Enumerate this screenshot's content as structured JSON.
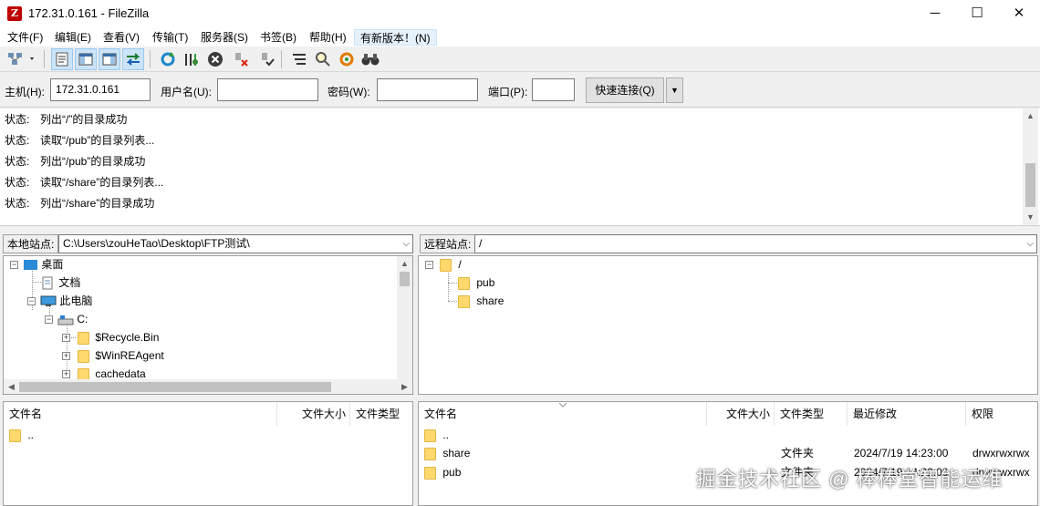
{
  "window": {
    "title": "172.31.0.161 - FileZilla",
    "app_icon_glyph": "Z",
    "controls": {
      "minimize": "─",
      "maximize": "☐",
      "close": "✕"
    }
  },
  "menu": {
    "file": "文件(F)",
    "edit": "编辑(E)",
    "view": "查看(V)",
    "transfer": "传输(T)",
    "server": "服务器(S)",
    "bookmarks": "书签(B)",
    "help": "帮助(H)",
    "update": "有新版本！(N)"
  },
  "toolbar_icons": [
    "site-manager",
    "message-log",
    "local-tree",
    "remote-tree",
    "transfer-queue",
    "refresh",
    "process-queue",
    "cancel",
    "disconnect",
    "reconnect",
    "directory-filters",
    "compare",
    "sync-browse",
    "search"
  ],
  "quickconnect": {
    "host_label": "主机(H):",
    "host_value": "172.31.0.161",
    "user_label": "用户名(U):",
    "user_value": "",
    "pass_label": "密码(W):",
    "pass_value": "",
    "port_label": "端口(P):",
    "port_value": "",
    "button": "快速连接(Q)"
  },
  "log": [
    {
      "type": "状态:",
      "text": "列出“/”的目录成功"
    },
    {
      "type": "状态:",
      "text": "读取“/pub”的目录列表..."
    },
    {
      "type": "状态:",
      "text": "列出“/pub”的目录成功"
    },
    {
      "type": "状态:",
      "text": "读取“/share”的目录列表..."
    },
    {
      "type": "状态:",
      "text": "列出“/share”的目录成功"
    }
  ],
  "local": {
    "label": "本地站点:",
    "path": "C:\\Users\\zouHeTao\\Desktop\\FTP测试\\",
    "tree": {
      "desktop": "桌面",
      "documents": "文档",
      "this_pc": "此电脑",
      "c_drive": "C:",
      "recycle": "$Recycle.Bin",
      "winre": "$WinREAgent",
      "cache": "cachedata"
    },
    "columns": {
      "name": "文件名",
      "size": "文件大小",
      "type": "文件类型"
    },
    "files": [
      {
        "name": ".."
      }
    ]
  },
  "remote": {
    "label": "远程站点:",
    "path": "/",
    "tree": {
      "root": "/",
      "pub": "pub",
      "share": "share"
    },
    "columns": {
      "name": "文件名",
      "size": "文件大小",
      "type": "文件类型",
      "modified": "最近修改",
      "perms": "权限"
    },
    "files": [
      {
        "name": "..",
        "type": "",
        "modified": "",
        "perms": ""
      },
      {
        "name": "share",
        "type": "文件夹",
        "modified": "2024/7/19 14:23:00",
        "perms": "drwxrwxrwx"
      },
      {
        "name": "pub",
        "type": "文件夹",
        "modified": "2024/7/19 14:22:00",
        "perms": "drwxrwxrwx"
      }
    ]
  },
  "watermark": "掘金技术社区 @ 棒棒堂智能运维"
}
